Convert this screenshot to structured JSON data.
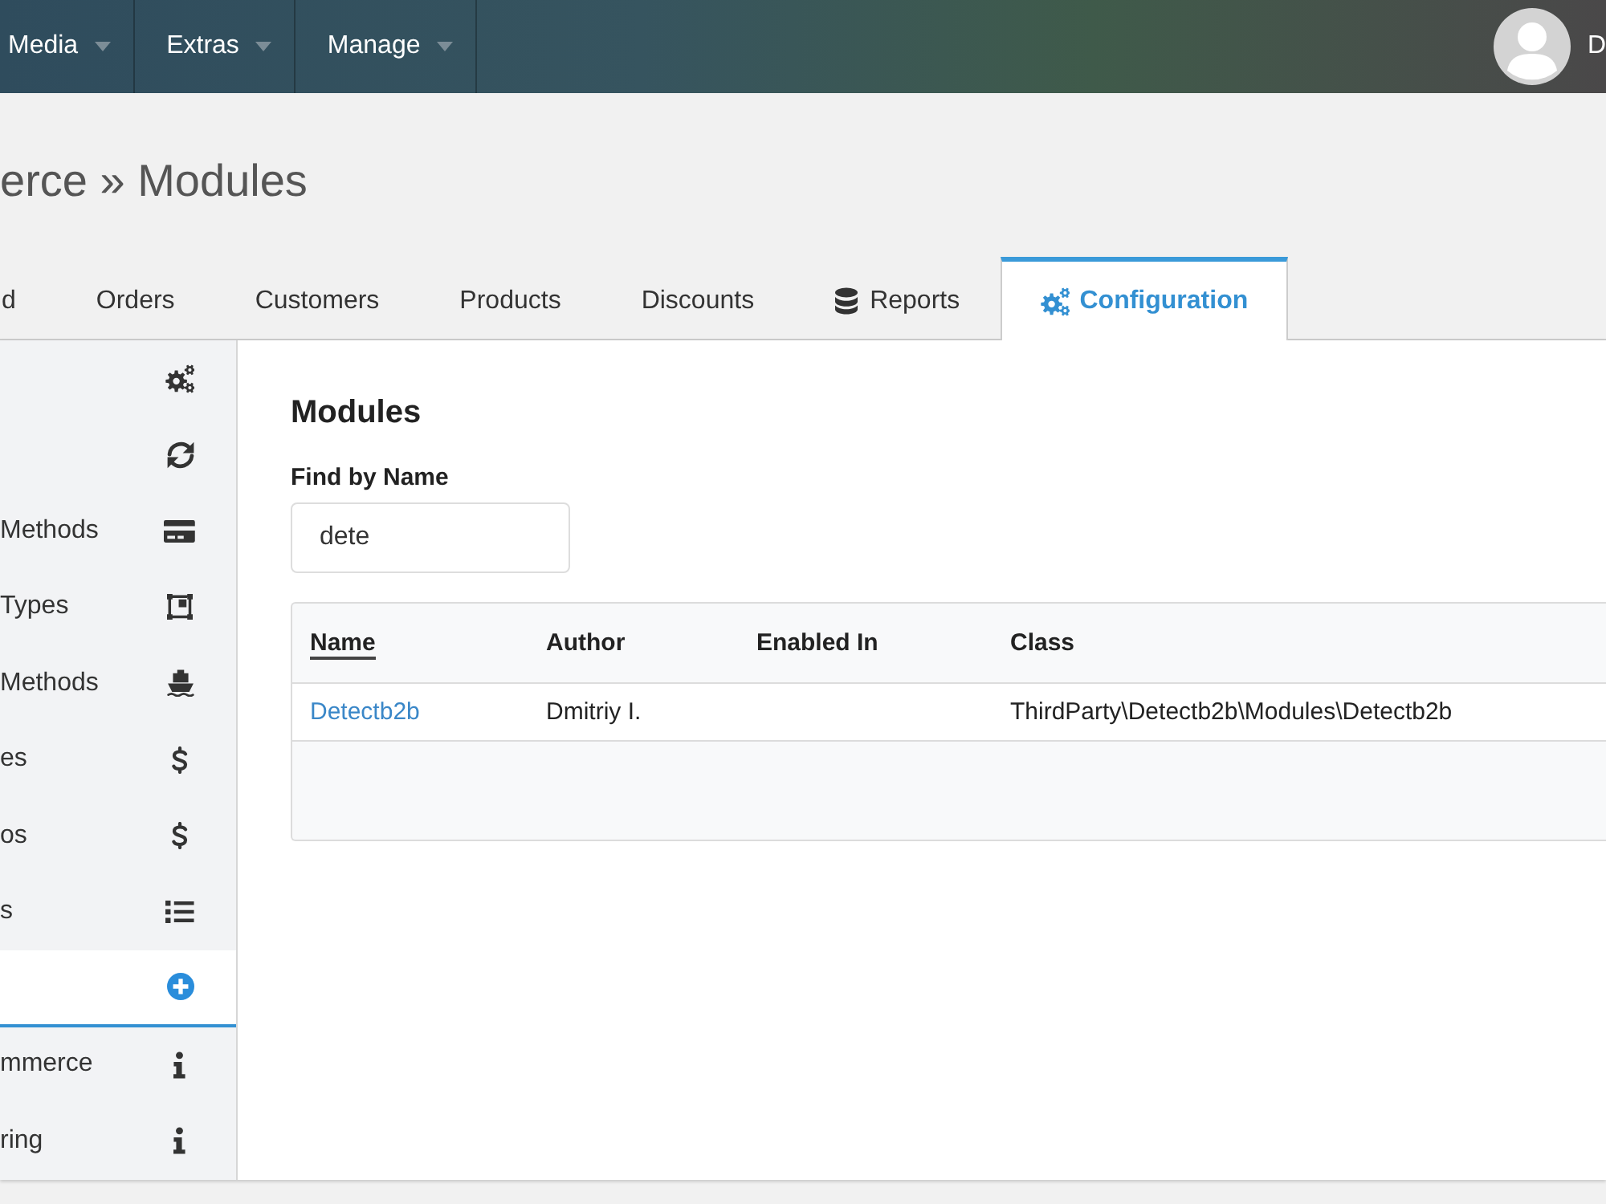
{
  "header": {
    "menus": [
      {
        "label": "Media"
      },
      {
        "label": "Extras"
      },
      {
        "label": "Manage"
      }
    ],
    "user": {
      "name": "D"
    }
  },
  "breadcrumb": "erce » Modules",
  "tabs": [
    {
      "label": "d",
      "selected": false
    },
    {
      "label": "Orders",
      "selected": false
    },
    {
      "label": "Customers",
      "selected": false
    },
    {
      "label": "Products",
      "selected": false
    },
    {
      "label": "Discounts",
      "selected": false
    },
    {
      "label": "Reports",
      "selected": false
    },
    {
      "label": "Configuration",
      "selected": true
    }
  ],
  "sidebar": {
    "items": [
      {
        "selected": false
      },
      {
        "selected": false
      },
      {
        "label": "Methods",
        "selected": false
      },
      {
        "label": "Types",
        "selected": false
      },
      {
        "label": "Methods",
        "selected": false
      },
      {
        "label": "es",
        "selected": false
      },
      {
        "label": "os",
        "selected": false
      },
      {
        "label": "s",
        "selected": false
      },
      {
        "selected": true
      },
      {
        "label": "mmerce",
        "selected": false
      },
      {
        "label": "ring",
        "selected": false
      }
    ]
  },
  "content": {
    "title": "Modules",
    "filter": {
      "label": "Find by Name",
      "value": "dete"
    },
    "table": {
      "columns": [
        {
          "label": "Name",
          "sorted": true
        },
        {
          "label": "Author",
          "sorted": false
        },
        {
          "label": "Enabled In",
          "sorted": false
        },
        {
          "label": "Class",
          "sorted": false
        }
      ],
      "rows": [
        {
          "name": "Detectb2b",
          "author": "Dmitriy I.",
          "class": "ThirdParty\\Detectb2b\\Modules\\Detectb2b"
        }
      ]
    }
  }
}
